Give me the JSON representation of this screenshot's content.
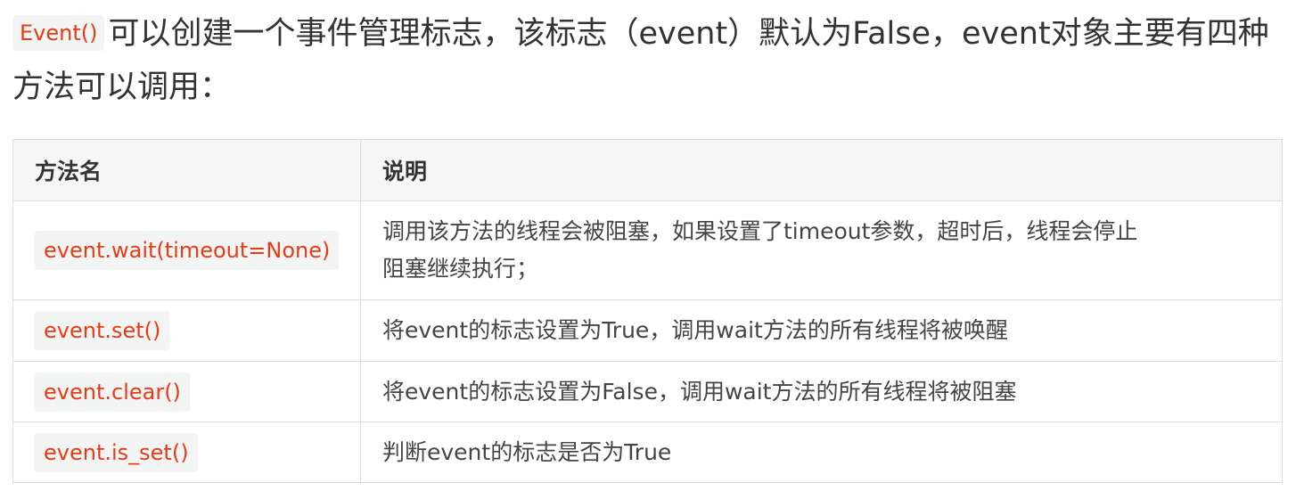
{
  "intro": {
    "code": "Event()",
    "line1_text": "可以创建一个事件管理标志，该标志（event）默认为False，event对象主要有四种",
    "line2_text": "方法可以调用："
  },
  "table": {
    "headers": [
      "方法名",
      "说明"
    ],
    "rows": [
      {
        "method": "event.wait(timeout=None)",
        "desc_line1": "调用该方法的线程会被阻塞，如果设置了timeout参数，超时后，线程会停止",
        "desc_line2": "阻塞继续执行；"
      },
      {
        "method": "event.set()",
        "desc": "将event的标志设置为True，调用wait方法的所有线程将被唤醒"
      },
      {
        "method": "event.clear()",
        "desc": "将event的标志设置为False，调用wait方法的所有线程将被阻塞"
      },
      {
        "method": "event.is_set()",
        "desc": "判断event的标志是否为True"
      }
    ]
  },
  "colors": {
    "code_text": "#e83a14",
    "code_bg": "#f3f4f4",
    "header_bg": "#f6f6f6",
    "border": "#dddddd"
  }
}
